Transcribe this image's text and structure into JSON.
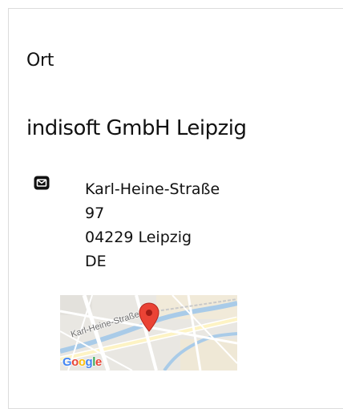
{
  "section": {
    "title": "Ort"
  },
  "location": {
    "name": "indisoft GmbH Leipzig",
    "address": {
      "street": "Karl-Heine-Straße",
      "house_number": "97",
      "postal_city": "04229 Leipzig",
      "country": "DE"
    },
    "contact_icon": "mail-icon"
  },
  "map": {
    "street_label": "Karl-Heine-Straße",
    "marker_icon": "map-pin-icon",
    "marker_color": "#ea4335",
    "logo": {
      "letters": [
        "G",
        "o",
        "o",
        "g",
        "l",
        "e"
      ]
    }
  }
}
